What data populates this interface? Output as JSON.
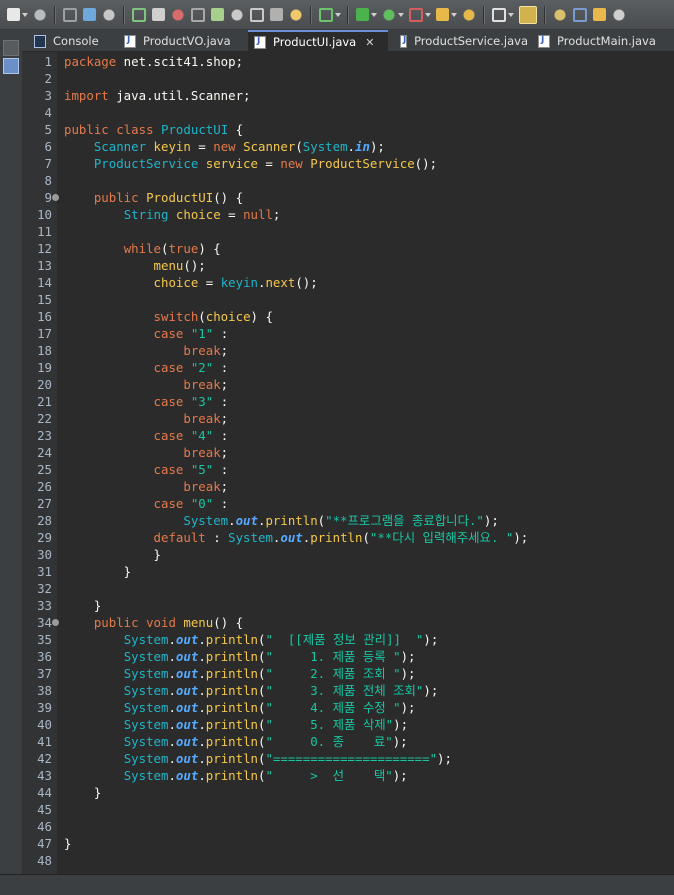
{
  "toolbar": {
    "icons": [
      "new-icon",
      "save-icon",
      "save-all-icon",
      "print-icon",
      "skip-breakpoints-icon",
      "resume-icon",
      "suspend-icon",
      "terminate-icon",
      "disconnect-icon",
      "step-into-icon",
      "step-over-icon",
      "step-return-icon",
      "drop-to-frame-icon",
      "use-step-filters-icon",
      "debug-icon",
      "run-icon",
      "run-last-icon",
      "coverage-icon",
      "open-type-icon",
      "open-task-icon",
      "search-icon",
      "toggle-mark-occurrences-icon",
      "highlight-icon",
      "next-annotation-icon",
      "previous-annotation-icon",
      "back-icon"
    ]
  },
  "tabs": [
    {
      "label": "Console",
      "icon": "console-icon",
      "active": false
    },
    {
      "label": "ProductVO.java",
      "icon": "java-file-icon",
      "active": false
    },
    {
      "label": "ProductUI.java",
      "icon": "java-file-icon",
      "active": true,
      "close": "✕"
    },
    {
      "label": "ProductService.java",
      "icon": "java-file-icon",
      "active": false
    },
    {
      "label": "ProductMain.java",
      "icon": "java-file-icon",
      "active": false
    }
  ],
  "editor": {
    "lines": [
      [
        [
          "k",
          "package"
        ],
        [
          "p",
          " net.scit41.shop;"
        ]
      ],
      [],
      [
        [
          "k",
          "import"
        ],
        [
          "p",
          " java.util.Scanner;"
        ]
      ],
      [],
      [
        [
          "k",
          "public"
        ],
        [
          "p",
          " "
        ],
        [
          "k",
          "class"
        ],
        [
          "p",
          " "
        ],
        [
          "t",
          "ProductUI"
        ],
        [
          "p",
          " {"
        ]
      ],
      [
        [
          "p",
          "    "
        ],
        [
          "t",
          "Scanner"
        ],
        [
          "p",
          " "
        ],
        [
          "m",
          "keyin"
        ],
        [
          "p",
          " = "
        ],
        [
          "k",
          "new"
        ],
        [
          "p",
          " "
        ],
        [
          "m",
          "Scanner"
        ],
        [
          "p",
          "("
        ],
        [
          "t",
          "System"
        ],
        [
          "p",
          "."
        ],
        [
          "f",
          "in"
        ],
        [
          "p",
          ");"
        ]
      ],
      [
        [
          "p",
          "    "
        ],
        [
          "t",
          "ProductService"
        ],
        [
          "p",
          " "
        ],
        [
          "m",
          "service"
        ],
        [
          "p",
          " = "
        ],
        [
          "k",
          "new"
        ],
        [
          "p",
          " "
        ],
        [
          "m",
          "ProductService"
        ],
        [
          "p",
          "();"
        ]
      ],
      [],
      [
        [
          "p",
          "    "
        ],
        [
          "k",
          "public"
        ],
        [
          "p",
          " "
        ],
        [
          "m",
          "ProductUI"
        ],
        [
          "p",
          "() {"
        ]
      ],
      [
        [
          "p",
          "        "
        ],
        [
          "t",
          "String"
        ],
        [
          "p",
          " "
        ],
        [
          "m",
          "choice"
        ],
        [
          "p",
          " = "
        ],
        [
          "k",
          "null"
        ],
        [
          "p",
          ";"
        ]
      ],
      [],
      [
        [
          "p",
          "        "
        ],
        [
          "k",
          "while"
        ],
        [
          "p",
          "("
        ],
        [
          "k",
          "true"
        ],
        [
          "p",
          ") {"
        ]
      ],
      [
        [
          "p",
          "            "
        ],
        [
          "m",
          "menu"
        ],
        [
          "p",
          "();"
        ]
      ],
      [
        [
          "p",
          "            "
        ],
        [
          "m",
          "choice"
        ],
        [
          "p",
          " = "
        ],
        [
          "t",
          "keyin"
        ],
        [
          "p",
          "."
        ],
        [
          "m",
          "next"
        ],
        [
          "p",
          "();"
        ]
      ],
      [],
      [
        [
          "p",
          "            "
        ],
        [
          "k",
          "switch"
        ],
        [
          "p",
          "("
        ],
        [
          "m",
          "choice"
        ],
        [
          "p",
          ") {"
        ]
      ],
      [
        [
          "p",
          "            "
        ],
        [
          "k",
          "case"
        ],
        [
          "p",
          " "
        ],
        [
          "s",
          "\"1\""
        ],
        [
          "p",
          " :"
        ]
      ],
      [
        [
          "p",
          "                "
        ],
        [
          "k",
          "break"
        ],
        [
          "p",
          ";"
        ]
      ],
      [
        [
          "p",
          "            "
        ],
        [
          "k",
          "case"
        ],
        [
          "p",
          " "
        ],
        [
          "s",
          "\"2\""
        ],
        [
          "p",
          " :"
        ]
      ],
      [
        [
          "p",
          "                "
        ],
        [
          "k",
          "break"
        ],
        [
          "p",
          ";"
        ]
      ],
      [
        [
          "p",
          "            "
        ],
        [
          "k",
          "case"
        ],
        [
          "p",
          " "
        ],
        [
          "s",
          "\"3\""
        ],
        [
          "p",
          " :"
        ]
      ],
      [
        [
          "p",
          "                "
        ],
        [
          "k",
          "break"
        ],
        [
          "p",
          ";"
        ]
      ],
      [
        [
          "p",
          "            "
        ],
        [
          "k",
          "case"
        ],
        [
          "p",
          " "
        ],
        [
          "s",
          "\"4\""
        ],
        [
          "p",
          " :"
        ]
      ],
      [
        [
          "p",
          "                "
        ],
        [
          "k",
          "break"
        ],
        [
          "p",
          ";"
        ]
      ],
      [
        [
          "p",
          "            "
        ],
        [
          "k",
          "case"
        ],
        [
          "p",
          " "
        ],
        [
          "s",
          "\"5\""
        ],
        [
          "p",
          " :"
        ]
      ],
      [
        [
          "p",
          "                "
        ],
        [
          "k",
          "break"
        ],
        [
          "p",
          ";"
        ]
      ],
      [
        [
          "p",
          "            "
        ],
        [
          "k",
          "case"
        ],
        [
          "p",
          " "
        ],
        [
          "s",
          "\"0\""
        ],
        [
          "p",
          " :"
        ]
      ],
      [
        [
          "p",
          "                "
        ],
        [
          "t",
          "System"
        ],
        [
          "p",
          "."
        ],
        [
          "f",
          "out"
        ],
        [
          "p",
          "."
        ],
        [
          "m",
          "println"
        ],
        [
          "p",
          "("
        ],
        [
          "s",
          "\"**프로그램을 종료합니다.\""
        ],
        [
          "p",
          ");"
        ]
      ],
      [
        [
          "p",
          "            "
        ],
        [
          "k",
          "default"
        ],
        [
          "p",
          " : "
        ],
        [
          "t",
          "System"
        ],
        [
          "p",
          "."
        ],
        [
          "f",
          "out"
        ],
        [
          "p",
          "."
        ],
        [
          "m",
          "println"
        ],
        [
          "p",
          "("
        ],
        [
          "s",
          "\"**다시 입력해주세요. \""
        ],
        [
          "p",
          ");"
        ]
      ],
      [
        [
          "p",
          "            }"
        ]
      ],
      [
        [
          "p",
          "        }"
        ]
      ],
      [],
      [
        [
          "p",
          "    }"
        ]
      ],
      [
        [
          "p",
          "    "
        ],
        [
          "k",
          "public"
        ],
        [
          "p",
          " "
        ],
        [
          "k",
          "void"
        ],
        [
          "p",
          " "
        ],
        [
          "m",
          "menu"
        ],
        [
          "p",
          "() {"
        ]
      ],
      [
        [
          "p",
          "        "
        ],
        [
          "t",
          "System"
        ],
        [
          "p",
          "."
        ],
        [
          "f",
          "out"
        ],
        [
          "p",
          "."
        ],
        [
          "m",
          "println"
        ],
        [
          "p",
          "("
        ],
        [
          "s",
          "\"  [[제품 정보 관리]]  \""
        ],
        [
          "p",
          ");"
        ]
      ],
      [
        [
          "p",
          "        "
        ],
        [
          "t",
          "System"
        ],
        [
          "p",
          "."
        ],
        [
          "f",
          "out"
        ],
        [
          "p",
          "."
        ],
        [
          "m",
          "println"
        ],
        [
          "p",
          "("
        ],
        [
          "s",
          "\"     1. 제품 등록 \""
        ],
        [
          "p",
          ");"
        ]
      ],
      [
        [
          "p",
          "        "
        ],
        [
          "t",
          "System"
        ],
        [
          "p",
          "."
        ],
        [
          "f",
          "out"
        ],
        [
          "p",
          "."
        ],
        [
          "m",
          "println"
        ],
        [
          "p",
          "("
        ],
        [
          "s",
          "\"     2. 제품 조회 \""
        ],
        [
          "p",
          ");"
        ]
      ],
      [
        [
          "p",
          "        "
        ],
        [
          "t",
          "System"
        ],
        [
          "p",
          "."
        ],
        [
          "f",
          "out"
        ],
        [
          "p",
          "."
        ],
        [
          "m",
          "println"
        ],
        [
          "p",
          "("
        ],
        [
          "s",
          "\"     3. 제품 전체 조회\""
        ],
        [
          "p",
          ");"
        ]
      ],
      [
        [
          "p",
          "        "
        ],
        [
          "t",
          "System"
        ],
        [
          "p",
          "."
        ],
        [
          "f",
          "out"
        ],
        [
          "p",
          "."
        ],
        [
          "m",
          "println"
        ],
        [
          "p",
          "("
        ],
        [
          "s",
          "\"     4. 제품 수정 \""
        ],
        [
          "p",
          ");"
        ]
      ],
      [
        [
          "p",
          "        "
        ],
        [
          "t",
          "System"
        ],
        [
          "p",
          "."
        ],
        [
          "f",
          "out"
        ],
        [
          "p",
          "."
        ],
        [
          "m",
          "println"
        ],
        [
          "p",
          "("
        ],
        [
          "s",
          "\"     5. 제품 삭제\""
        ],
        [
          "p",
          ");"
        ]
      ],
      [
        [
          "p",
          "        "
        ],
        [
          "t",
          "System"
        ],
        [
          "p",
          "."
        ],
        [
          "f",
          "out"
        ],
        [
          "p",
          "."
        ],
        [
          "m",
          "println"
        ],
        [
          "p",
          "("
        ],
        [
          "s",
          "\"     0. 종    료\""
        ],
        [
          "p",
          ");"
        ]
      ],
      [
        [
          "p",
          "        "
        ],
        [
          "t",
          "System"
        ],
        [
          "p",
          "."
        ],
        [
          "f",
          "out"
        ],
        [
          "p",
          "."
        ],
        [
          "m",
          "println"
        ],
        [
          "p",
          "("
        ],
        [
          "s",
          "\"=====================\""
        ],
        [
          "p",
          ");"
        ]
      ],
      [
        [
          "p",
          "        "
        ],
        [
          "t",
          "System"
        ],
        [
          "p",
          "."
        ],
        [
          "f",
          "out"
        ],
        [
          "p",
          "."
        ],
        [
          "m",
          "println"
        ],
        [
          "p",
          "("
        ],
        [
          "s",
          "\"     >  선    택\""
        ],
        [
          "p",
          ");"
        ]
      ],
      [
        [
          "p",
          "    }"
        ]
      ],
      [],
      [],
      [
        [
          "p",
          "}"
        ]
      ],
      []
    ],
    "fold_markers": [
      9,
      34
    ]
  },
  "colors": {
    "keyword": "#e5794b",
    "type": "#1eb5c9",
    "method": "#f5c84c",
    "string": "#17c6a3",
    "field": "#55aaff",
    "background": "#2b2b2b"
  }
}
